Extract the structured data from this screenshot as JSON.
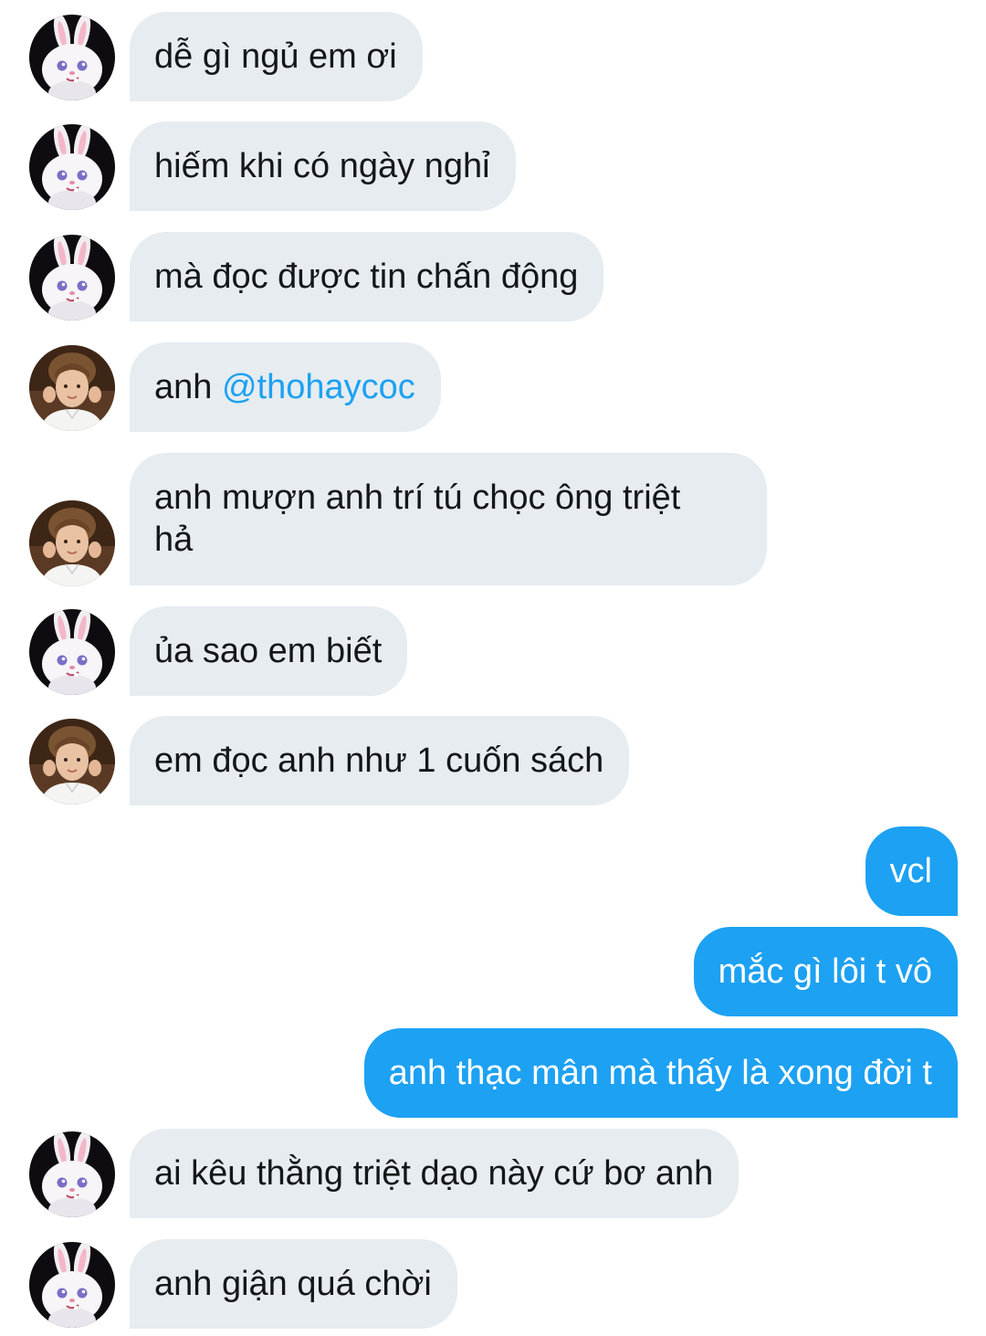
{
  "conversation": {
    "messages": [
      {
        "sender": "bunny",
        "text": "dễ gì ngủ em ơi"
      },
      {
        "sender": "bunny",
        "text": "hiếm khi có ngày nghỉ"
      },
      {
        "sender": "bunny",
        "text": "mà đọc được tin chấn động"
      },
      {
        "sender": "boy",
        "text_prefix": "anh ",
        "mention": "@thohaycoc"
      },
      {
        "sender": "boy",
        "text": "anh mượn anh trí tú chọc ông triệt\nhả"
      },
      {
        "sender": "bunny",
        "text": "ủa sao em biết"
      },
      {
        "sender": "boy",
        "text": "em đọc anh như 1 cuốn sách"
      },
      {
        "sender": "me",
        "text": "vcl"
      },
      {
        "sender": "me",
        "text": "mắc gì lôi t vô"
      },
      {
        "sender": "me",
        "text": "anh thạc mân mà thấy là xong đời t"
      },
      {
        "sender": "bunny",
        "text": "ai kêu thằng triệt dạo này cứ bơ anh"
      },
      {
        "sender": "bunny",
        "text": "anh giận quá chời"
      }
    ]
  },
  "colors": {
    "incoming_bubble": "#e6ecf0",
    "outgoing_bubble": "#1da1f2",
    "mention": "#1da1f2",
    "text": "#14171a"
  },
  "icons": {
    "bunny_avatar": "white-bunny-avatar-icon",
    "boy_avatar": "user-photo-avatar-icon"
  }
}
